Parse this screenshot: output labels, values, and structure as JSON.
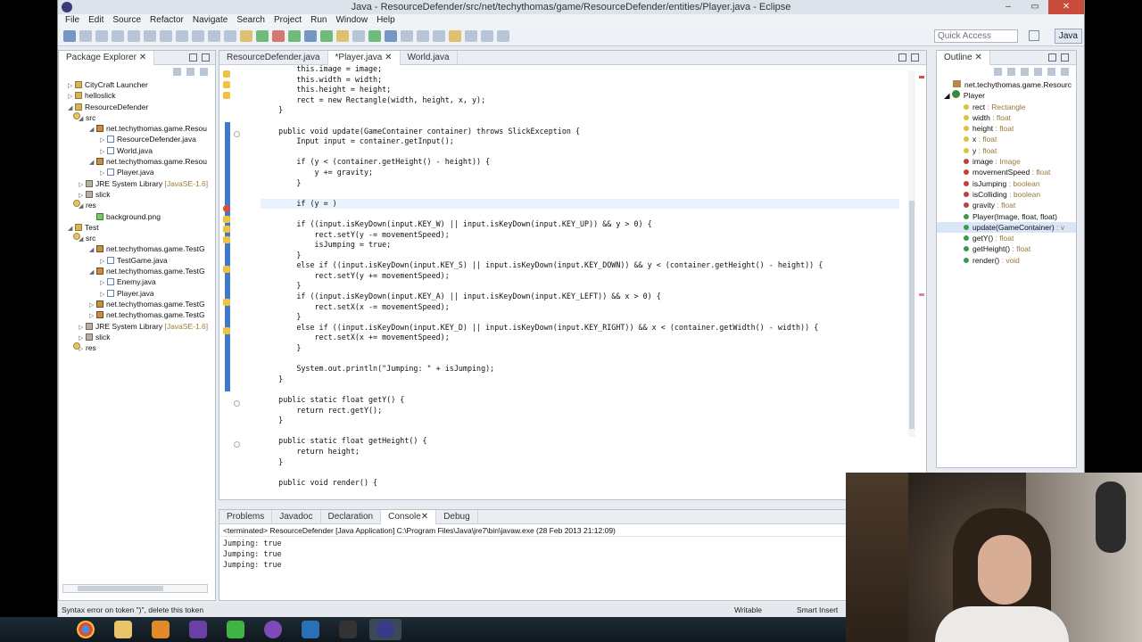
{
  "window": {
    "title": "Java - ResourceDefender/src/net/techythomas/game/ResourceDefender/entities/Player.java - Eclipse",
    "controls": [
      "–",
      "▭",
      "✕"
    ]
  },
  "menu": [
    "File",
    "Edit",
    "Source",
    "Refactor",
    "Navigate",
    "Search",
    "Project",
    "Run",
    "Window",
    "Help"
  ],
  "toolbar": {
    "quick_access_placeholder": "Quick Access",
    "perspective": "Java"
  },
  "package_explorer": {
    "title": "Package Explorer",
    "items": [
      {
        "label": "CityCraft Launcher",
        "dec": ""
      },
      {
        "label": "helloslick",
        "dec": ""
      },
      {
        "label": "ResourceDefender",
        "dec": ""
      },
      {
        "label": "src",
        "dec": ""
      },
      {
        "label": "net.techythomas.game.Resou",
        "dec": ""
      },
      {
        "label": "ResourceDefender.java",
        "dec": ""
      },
      {
        "label": "World.java",
        "dec": ""
      },
      {
        "label": "net.techythomas.game.Resou",
        "dec": ""
      },
      {
        "label": "Player.java",
        "dec": ""
      },
      {
        "label": "JRE System Library",
        "dec": " [JavaSE-1.6]"
      },
      {
        "label": "slick",
        "dec": ""
      },
      {
        "label": "res",
        "dec": ""
      },
      {
        "label": "background.png",
        "dec": ""
      },
      {
        "label": "Test",
        "dec": ""
      },
      {
        "label": "src",
        "dec": ""
      },
      {
        "label": "net.techythomas.game.TestG",
        "dec": ""
      },
      {
        "label": "TestGame.java",
        "dec": ""
      },
      {
        "label": "net.techythomas.game.TestG",
        "dec": ""
      },
      {
        "label": "Enemy.java",
        "dec": ""
      },
      {
        "label": "Player.java",
        "dec": ""
      },
      {
        "label": "net.techythomas.game.TestG",
        "dec": ""
      },
      {
        "label": "net.techythomas.game.TestG",
        "dec": ""
      },
      {
        "label": "JRE System Library",
        "dec": " [JavaSE-1.6]"
      },
      {
        "label": "slick",
        "dec": ""
      },
      {
        "label": "res",
        "dec": ""
      }
    ]
  },
  "editor": {
    "tabs": [
      "ResourceDefender.java",
      "*Player.java",
      "World.java"
    ],
    "code": [
      "        this.image = image;",
      "        this.width = width;",
      "        this.height = height;",
      "        rect = new Rectangle(width, height, x, y);",
      "    }",
      "",
      "    public void update(GameContainer container) throws SlickException {",
      "        Input input = container.getInput();",
      "",
      "        if (y < (container.getHeight() - height)) {",
      "            y += gravity;",
      "        }",
      "",
      "        if (y = )",
      "",
      "        if ((input.isKeyDown(input.KEY_W) || input.isKeyDown(input.KEY_UP)) && y > 0) {",
      "            rect.setY(y -= movementSpeed);",
      "            isJumping = true;",
      "        }",
      "        else if ((input.isKeyDown(input.KEY_S) || input.isKeyDown(input.KEY_DOWN)) && y < (container.getHeight() - height)) {",
      "            rect.setY(y += movementSpeed);",
      "        }",
      "        if ((input.isKeyDown(input.KEY_A) || input.isKeyDown(input.KEY_LEFT)) && x > 0) {",
      "            rect.setX(x -= movementSpeed);",
      "        }",
      "        else if ((input.isKeyDown(input.KEY_D) || input.isKeyDown(input.KEY_RIGHT)) && x < (container.getWidth() - width)) {",
      "            rect.setX(x += movementSpeed);",
      "        }",
      "",
      "        System.out.println(\"Jumping: \" + isJumping);",
      "    }",
      "",
      "    public static float getY() {",
      "        return rect.getY();",
      "    }",
      "",
      "    public static float getHeight() {",
      "        return height;",
      "    }",
      "",
      "    public void render() {"
    ]
  },
  "outline": {
    "title": "Outline",
    "items": [
      {
        "label": "net.techythomas.game.Resourc",
        "type": ""
      },
      {
        "label": "Player",
        "type": ""
      },
      {
        "label": "rect",
        "type": " : Rectangle"
      },
      {
        "label": "width",
        "type": " : float"
      },
      {
        "label": "height",
        "type": " : float"
      },
      {
        "label": "x",
        "type": " : float"
      },
      {
        "label": "y",
        "type": " : float"
      },
      {
        "label": "image",
        "type": " : Image"
      },
      {
        "label": "movementSpeed",
        "type": " : float"
      },
      {
        "label": "isJumping",
        "type": " : boolean"
      },
      {
        "label": "isColliding",
        "type": " : boolean"
      },
      {
        "label": "gravity",
        "type": " : float"
      },
      {
        "label": "Player(Image, float, float)",
        "type": ""
      },
      {
        "label": "update(GameContainer)",
        "type": " : v"
      },
      {
        "label": "getY()",
        "type": " : float"
      },
      {
        "label": "getHeight()",
        "type": " : float"
      },
      {
        "label": "render()",
        "type": " : void"
      }
    ]
  },
  "console": {
    "tabs": [
      "Problems",
      "Javadoc",
      "Declaration",
      "Console",
      "Debug"
    ],
    "info": "<terminated> ResourceDefender [Java Application] C:\\Program Files\\Java\\jre7\\bin\\javaw.exe (28 Feb 2013 21:12:09)",
    "lines": [
      "Jumping: true",
      "Jumping: true",
      "Jumping: true"
    ]
  },
  "status": {
    "message": "Syntax error on token \")\", delete this token",
    "writable": "Writable",
    "insert": "Smart Insert"
  },
  "colors": {
    "accent": "#3f79c9",
    "error": "#e14a3c",
    "warning": "#f0c23f"
  }
}
